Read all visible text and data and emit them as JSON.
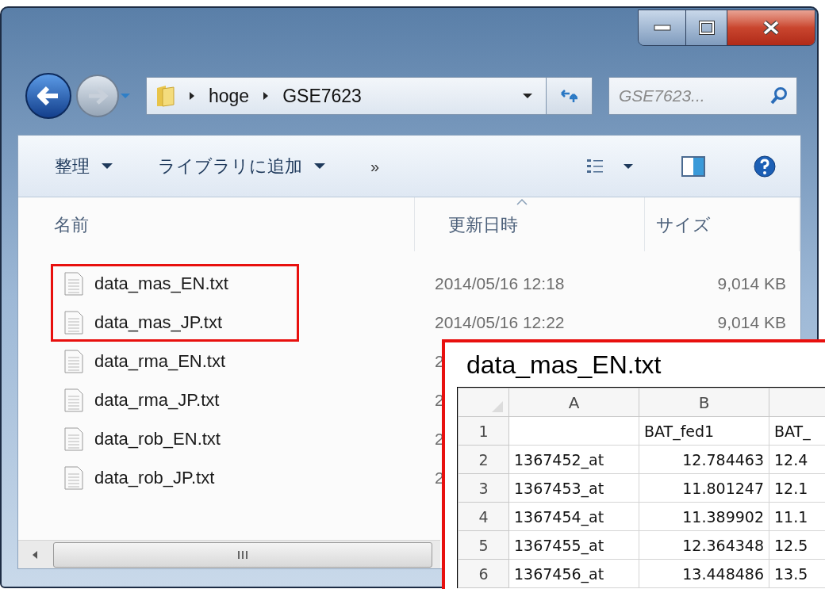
{
  "address_bar": {
    "path": [
      "hoge",
      "GSE7623"
    ]
  },
  "search": {
    "placeholder": "GSE7623..."
  },
  "toolbar": {
    "items": [
      {
        "label": "整理",
        "kind": "menu"
      },
      {
        "label": "ライブラリに追加",
        "kind": "menu"
      },
      {
        "label": "»",
        "kind": "more"
      }
    ]
  },
  "columns": [
    {
      "label": "名前",
      "sorted": false
    },
    {
      "label": "更新日時",
      "sorted": true
    },
    {
      "label": "サイズ",
      "sorted": false
    }
  ],
  "files": [
    {
      "name": "data_mas_EN.txt",
      "modified": "2014/05/16 12:18",
      "size": "9,014 KB",
      "marked": true
    },
    {
      "name": "data_mas_JP.txt",
      "modified": "2014/05/16 12:22",
      "size": "9,014 KB",
      "marked": true
    },
    {
      "name": "data_rma_EN.txt",
      "modified": "2",
      "marked": false
    },
    {
      "name": "data_rma_JP.txt",
      "modified": "2",
      "marked": false
    },
    {
      "name": "data_rob_EN.txt",
      "modified": "2",
      "marked": false
    },
    {
      "name": "data_rob_JP.txt",
      "modified": "2",
      "marked": false
    }
  ],
  "preview": {
    "title": "data_mas_EN.txt",
    "sheet": {
      "columns": [
        "A",
        "B"
      ],
      "rows": [
        {
          "number": "1",
          "cells": [
            null,
            "BAT_fed1",
            "BAT_"
          ]
        },
        {
          "number": "2",
          "cells": [
            "1367452_at",
            "12.784463",
            "12.4"
          ]
        },
        {
          "number": "3",
          "cells": [
            "1367453_at",
            "11.801247",
            "12.1"
          ]
        },
        {
          "number": "4",
          "cells": [
            "1367454_at",
            "11.389902",
            "11.1"
          ]
        },
        {
          "number": "5",
          "cells": [
            "1367455_at",
            "12.364348",
            "12.5"
          ]
        },
        {
          "number": "6",
          "cells": [
            "1367456_at",
            "13.448486",
            "13.5"
          ]
        }
      ]
    }
  }
}
